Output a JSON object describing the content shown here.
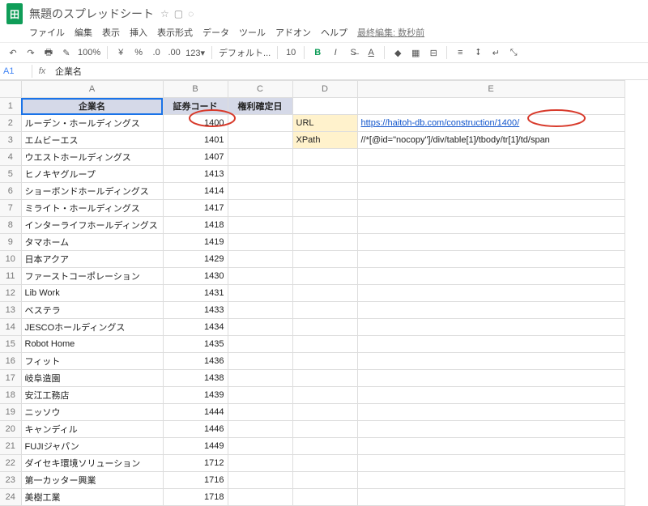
{
  "doc": {
    "title": "無題のスプレッドシート",
    "last_edit": "最終編集: 数秒前"
  },
  "menus": [
    "ファイル",
    "編集",
    "表示",
    "挿入",
    "表示形式",
    "データ",
    "ツール",
    "アドオン",
    "ヘルプ"
  ],
  "toolbar": {
    "zoom": "100%",
    "font": "デフォルト...",
    "size": "10",
    "more": "123▾"
  },
  "fx": {
    "name": "A1",
    "value": "企業名"
  },
  "cols": [
    "A",
    "B",
    "C",
    "D",
    "E"
  ],
  "headers": {
    "A": "企業名",
    "B": "証券コード",
    "C": "権利確定日"
  },
  "side": {
    "url_label": "URL",
    "url_value": "https://haitoh-db.com/construction/1400/",
    "xpath_label": "XPath",
    "xpath_value": "//*[@id=\"nocopy\"]/div/table[1]/tbody/tr[1]/td/span"
  },
  "chart_data": {
    "type": "table",
    "columns": [
      "企業名",
      "証券コード"
    ],
    "rows": [
      [
        "ルーデン・ホールディングス",
        "1400"
      ],
      [
        "エムビーエス",
        "1401"
      ],
      [
        "ウエストホールディングス",
        "1407"
      ],
      [
        "ヒノキヤグループ",
        "1413"
      ],
      [
        "ショーボンドホールディングス",
        "1414"
      ],
      [
        "ミライト・ホールディングス",
        "1417"
      ],
      [
        "インターライフホールディングス",
        "1418"
      ],
      [
        "タマホーム",
        "1419"
      ],
      [
        "日本アクア",
        "1429"
      ],
      [
        "ファーストコーポレーション",
        "1430"
      ],
      [
        "Lib Work",
        "1431"
      ],
      [
        "ベステラ",
        "1433"
      ],
      [
        "JESCOホールディングス",
        "1434"
      ],
      [
        "Robot Home",
        "1435"
      ],
      [
        "フィット",
        "1436"
      ],
      [
        "岐阜造園",
        "1438"
      ],
      [
        "安江工務店",
        "1439"
      ],
      [
        "ニッソウ",
        "1444"
      ],
      [
        "キャンディル",
        "1446"
      ],
      [
        "FUJIジャパン",
        "1449"
      ],
      [
        "ダイセキ環境ソリューション",
        "1712"
      ],
      [
        "第一カッター興業",
        "1716"
      ],
      [
        "美樹工業",
        "1718"
      ]
    ]
  }
}
